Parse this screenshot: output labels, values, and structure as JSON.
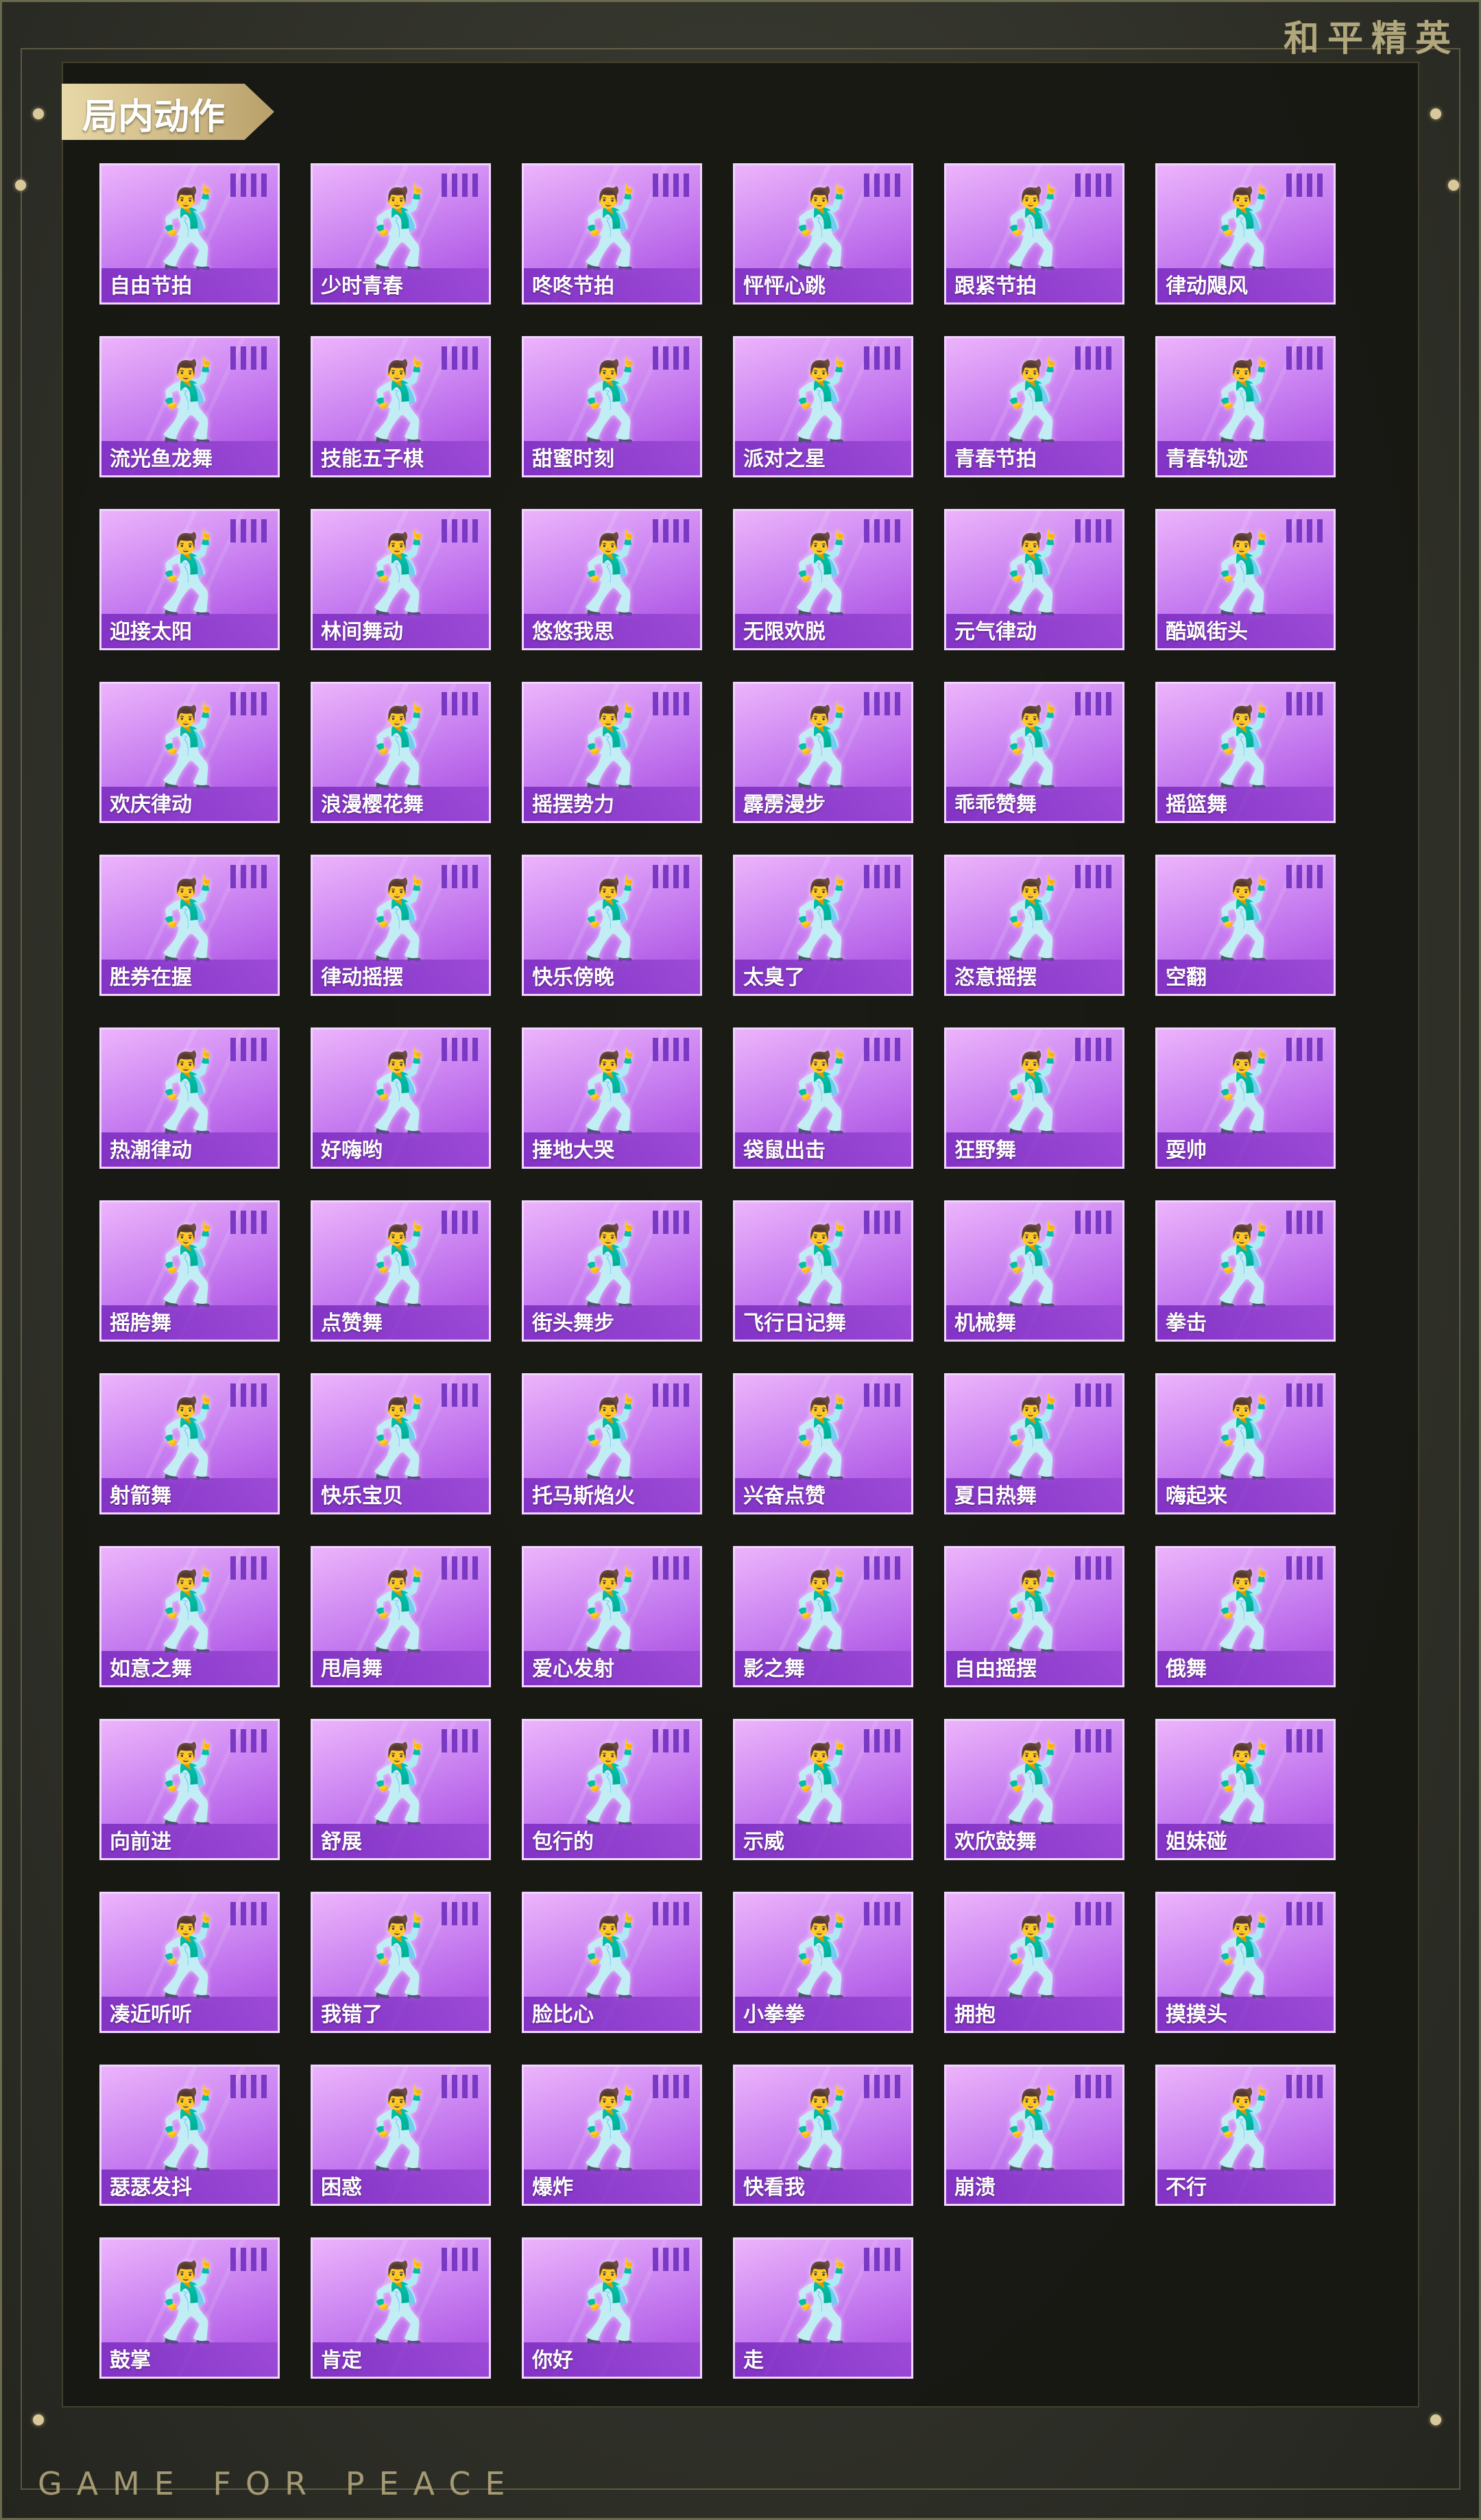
{
  "brand": "和平精英",
  "footer_brand": "GAME FOR PEACE",
  "section_title": "局内动作",
  "emote_icon": "dancing-figure-icon",
  "colors": {
    "card_top": "#ecb4fb",
    "card_bottom": "#a447df",
    "card_border": "#f0d6ff",
    "tag_gold": "#e8d9a8"
  },
  "emotes": [
    {
      "label": "自由节拍"
    },
    {
      "label": "少时青春"
    },
    {
      "label": "咚咚节拍"
    },
    {
      "label": "怦怦心跳"
    },
    {
      "label": "跟紧节拍"
    },
    {
      "label": "律动飓风"
    },
    {
      "label": "流光鱼龙舞"
    },
    {
      "label": "技能五子棋"
    },
    {
      "label": "甜蜜时刻"
    },
    {
      "label": "派对之星"
    },
    {
      "label": "青春节拍"
    },
    {
      "label": "青春轨迹"
    },
    {
      "label": "迎接太阳"
    },
    {
      "label": "林间舞动"
    },
    {
      "label": "悠悠我思"
    },
    {
      "label": "无限欢脱"
    },
    {
      "label": "元气律动"
    },
    {
      "label": "酷飒街头"
    },
    {
      "label": "欢庆律动"
    },
    {
      "label": "浪漫樱花舞"
    },
    {
      "label": "摇摆势力"
    },
    {
      "label": "霹雳漫步"
    },
    {
      "label": "乖乖赞舞"
    },
    {
      "label": "摇篮舞"
    },
    {
      "label": "胜券在握"
    },
    {
      "label": "律动摇摆"
    },
    {
      "label": "快乐傍晚"
    },
    {
      "label": "太臭了"
    },
    {
      "label": "恣意摇摆"
    },
    {
      "label": "空翻"
    },
    {
      "label": "热潮律动"
    },
    {
      "label": "好嗨哟"
    },
    {
      "label": "捶地大哭"
    },
    {
      "label": "袋鼠出击"
    },
    {
      "label": "狂野舞"
    },
    {
      "label": "耍帅"
    },
    {
      "label": "摇胯舞"
    },
    {
      "label": "点赞舞"
    },
    {
      "label": "街头舞步"
    },
    {
      "label": "飞行日记舞"
    },
    {
      "label": "机械舞"
    },
    {
      "label": "拳击"
    },
    {
      "label": "射箭舞"
    },
    {
      "label": "快乐宝贝"
    },
    {
      "label": "托马斯焰火"
    },
    {
      "label": "兴奋点赞"
    },
    {
      "label": "夏日热舞"
    },
    {
      "label": "嗨起来"
    },
    {
      "label": "如意之舞"
    },
    {
      "label": "甩肩舞"
    },
    {
      "label": "爱心发射"
    },
    {
      "label": "影之舞"
    },
    {
      "label": "自由摇摆"
    },
    {
      "label": "俄舞"
    },
    {
      "label": "向前进"
    },
    {
      "label": "舒展"
    },
    {
      "label": "包行的"
    },
    {
      "label": "示威"
    },
    {
      "label": "欢欣鼓舞"
    },
    {
      "label": "姐妹碰"
    },
    {
      "label": "凑近听听"
    },
    {
      "label": "我错了"
    },
    {
      "label": "脸比心"
    },
    {
      "label": "小拳拳"
    },
    {
      "label": "拥抱"
    },
    {
      "label": "摸摸头"
    },
    {
      "label": "瑟瑟发抖"
    },
    {
      "label": "困惑"
    },
    {
      "label": "爆炸"
    },
    {
      "label": "快看我"
    },
    {
      "label": "崩溃"
    },
    {
      "label": "不行"
    },
    {
      "label": "鼓掌"
    },
    {
      "label": "肯定"
    },
    {
      "label": "你好"
    },
    {
      "label": "走"
    }
  ]
}
